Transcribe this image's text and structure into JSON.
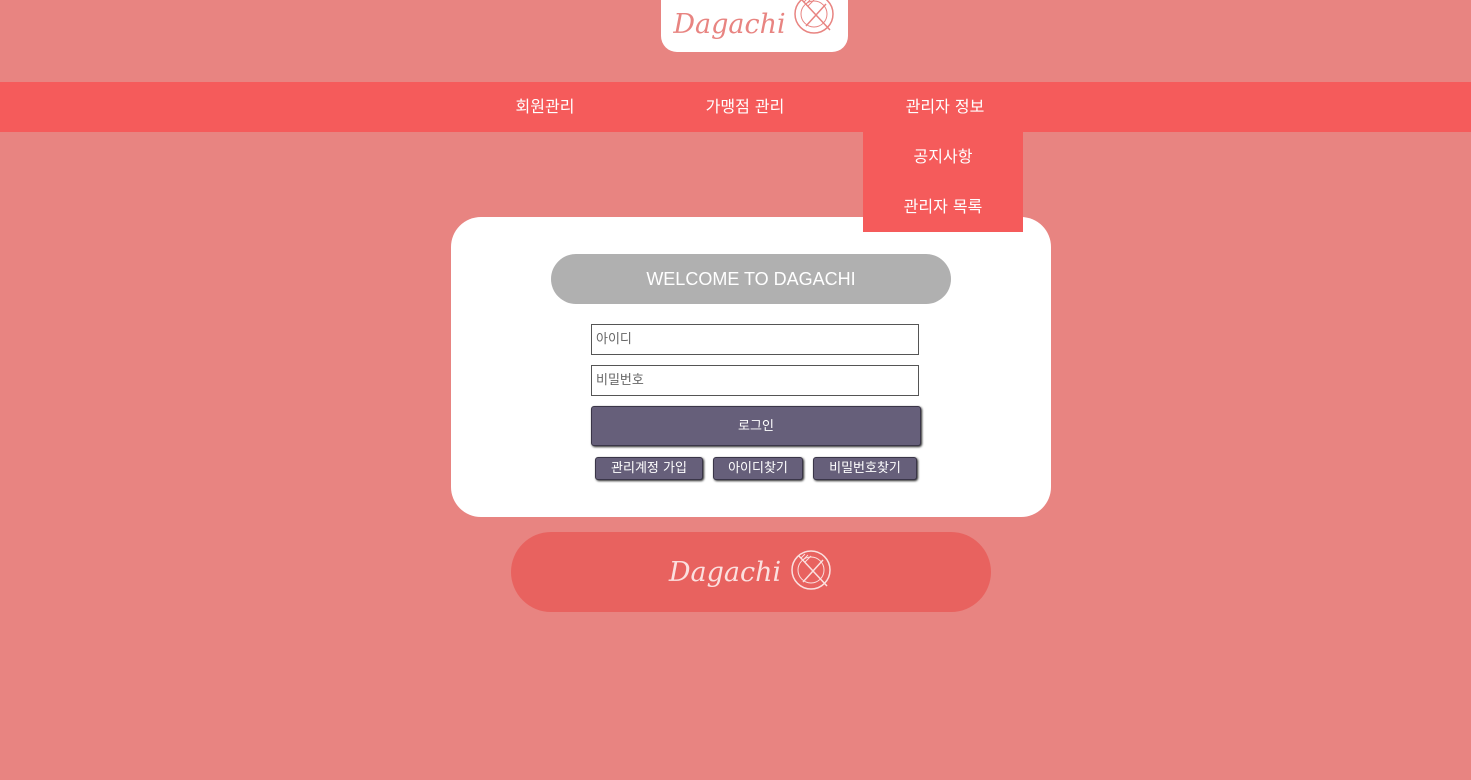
{
  "header": {
    "logo_text": "Dagachi",
    "logo_icon": "plate-fork-knife-icon"
  },
  "nav": {
    "items": [
      {
        "label": "회원관리"
      },
      {
        "label": "가맹점 관리"
      },
      {
        "label": "관리자 정보"
      }
    ],
    "dropdown": [
      {
        "label": "공지사항"
      },
      {
        "label": "관리자 목록"
      }
    ]
  },
  "login": {
    "welcome": "WELCOME TO DAGACHI",
    "id_placeholder": "아이디",
    "id_value": "",
    "pw_placeholder": "비밀번호",
    "pw_value": "",
    "login_label": "로그인",
    "signup_label": "관리계정 가입",
    "find_id_label": "아이디찾기",
    "find_pw_label": "비밀번호찾기"
  },
  "footer": {
    "logo_text": "Dagachi",
    "logo_icon": "plate-fork-knife-icon"
  },
  "colors": {
    "background": "#e88481",
    "nav": "#f55b5b",
    "button": "#665f7a",
    "welcome_pill": "#b0b0b0",
    "footer_banner": "#e8625f"
  }
}
